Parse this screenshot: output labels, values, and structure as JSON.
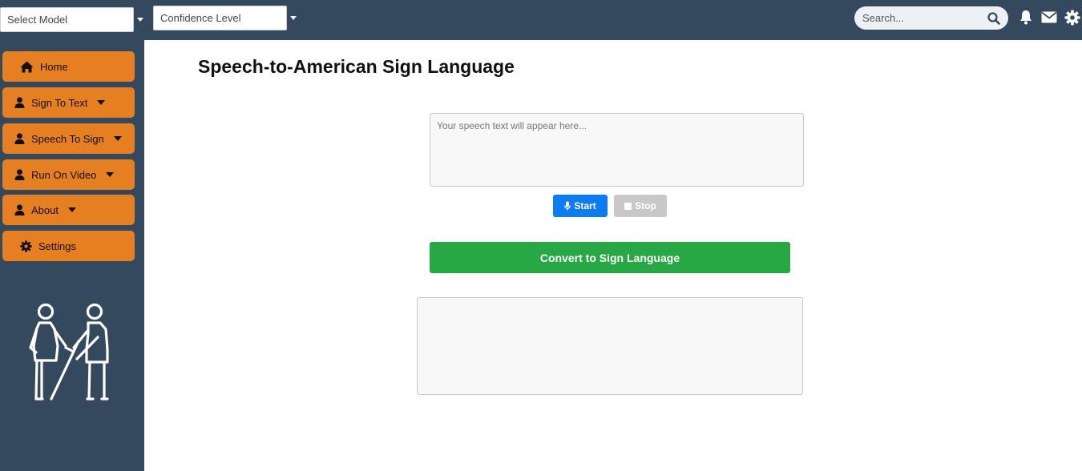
{
  "topbar": {
    "model_select": {
      "value": "Select Model"
    },
    "confidence_select": {
      "value": "Confidence Level"
    },
    "search": {
      "placeholder": "Search..."
    }
  },
  "sidebar": {
    "items": [
      {
        "label": "Home",
        "icon": "home-icon",
        "has_caret": false
      },
      {
        "label": "Sign To Text",
        "icon": "user-icon",
        "has_caret": true
      },
      {
        "label": "Speech To Sign",
        "icon": "user-icon",
        "has_caret": true
      },
      {
        "label": "Run On Video",
        "icon": "user-icon",
        "has_caret": true
      },
      {
        "label": "About",
        "icon": "user-icon",
        "has_caret": true
      },
      {
        "label": "Settings",
        "icon": "gear-icon",
        "has_caret": false
      }
    ]
  },
  "main": {
    "title": "Speech-to-American Sign Language",
    "speech_placeholder": "Your speech text will appear here...",
    "start_label": "Start",
    "stop_label": "Stop",
    "convert_label": "Convert to Sign Language"
  },
  "colors": {
    "nav_bg": "#34495e",
    "sidebar_button": "#e67e22",
    "start_button": "#0d7cf2",
    "stop_button": "#c8c8c8",
    "convert_button": "#28a745"
  }
}
